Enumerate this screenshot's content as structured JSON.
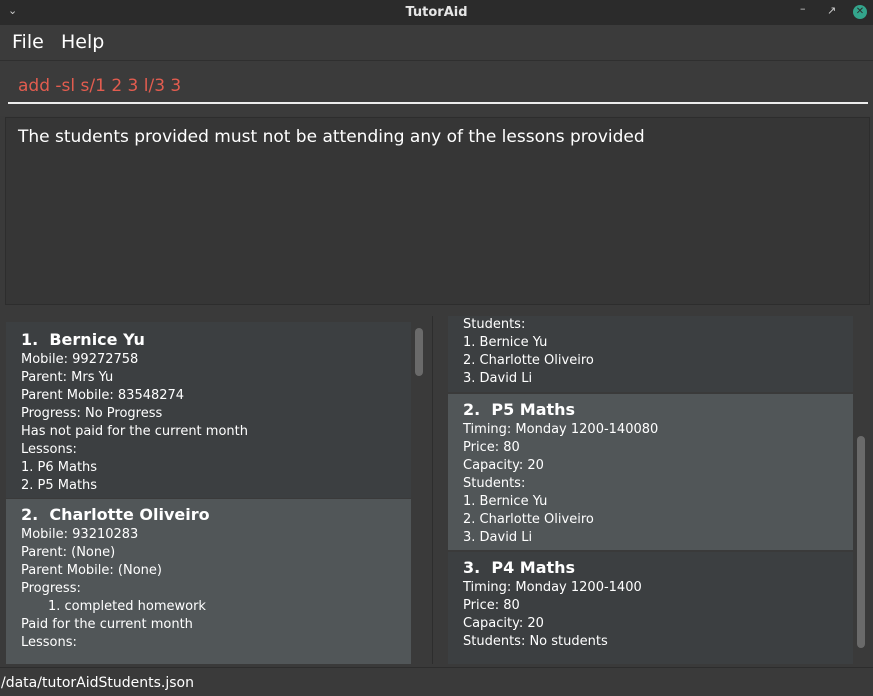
{
  "window": {
    "title": "TutorAid",
    "minimize_icon": "chevron-down-icon",
    "restore_icon": "restore-icon",
    "close_icon": "close-icon"
  },
  "menu": {
    "file": "File",
    "help": "Help"
  },
  "command": {
    "value": "add -sl s/1 2 3 l/3 3"
  },
  "result": {
    "message": "The students provided must not be attending any of the lessons provided"
  },
  "students": [
    {
      "index": "1.",
      "name": "Bernice Yu",
      "lines": [
        "Mobile: 99272758",
        "Parent: Mrs Yu",
        "Parent Mobile: 83548274",
        "Progress: No Progress",
        "Has not paid for the current month",
        "Lessons:",
        "1.  P6 Maths",
        "2.  P5 Maths"
      ]
    },
    {
      "index": "2.",
      "name": "Charlotte Oliveiro",
      "lines": [
        "Mobile: 93210283",
        "Parent: (None)",
        "Parent Mobile: (None)",
        "Progress:",
        "1. completed homework",
        "Paid for the current month",
        "Lessons:"
      ]
    }
  ],
  "lessons_partial": {
    "lines": [
      "Students:",
      "1.  Bernice Yu",
      "2.  Charlotte Oliveiro",
      "3.  David Li"
    ]
  },
  "lessons": [
    {
      "index": "2.",
      "name": "P5 Maths",
      "lines": [
        "Timing: Monday 1200-140080",
        "Price: 80",
        "Capacity: 20",
        "Students:",
        "1.  Bernice Yu",
        "2.  Charlotte Oliveiro",
        "3.  David Li"
      ]
    },
    {
      "index": "3.",
      "name": "P4 Maths",
      "lines": [
        "Timing: Monday 1200-1400",
        "Price: 80",
        "Capacity: 20",
        "Students: No students"
      ]
    }
  ],
  "status": {
    "path": "/data/tutorAidStudents.json"
  }
}
